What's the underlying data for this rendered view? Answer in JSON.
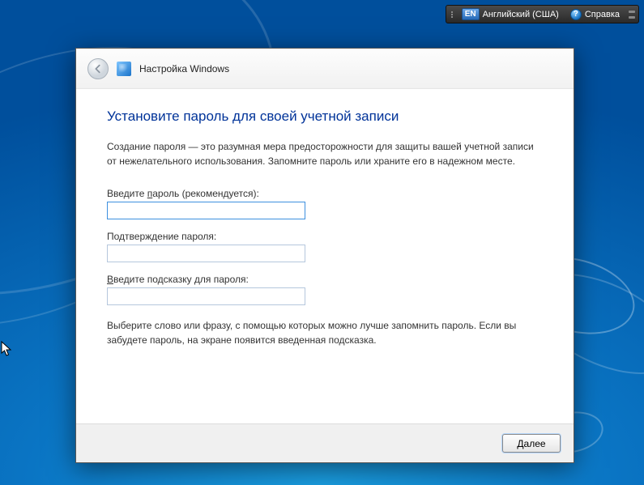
{
  "langbar": {
    "lang_code": "EN",
    "lang_label": "Английский (США)",
    "help_label": "Справка"
  },
  "dialog": {
    "window_title": "Настройка Windows",
    "heading": "Установите пароль для своей учетной записи",
    "description": "Создание пароля — это разумная мера предосторожности для защиты вашей учетной записи от нежелательного использования. Запомните пароль или храните его в надежном месте.",
    "password_label_pre": "Введите ",
    "password_label_ul": "п",
    "password_label_post": "ароль (рекомендуется):",
    "password_value": "",
    "confirm_label": "Подтверждение пароля:",
    "confirm_value": "",
    "hint_label_pre": "",
    "hint_label_ul": "В",
    "hint_label_post": "ведите подсказку для пароля:",
    "hint_value": "",
    "hint_help": "Выберите слово или фразу, с помощью которых можно лучше запомнить пароль. Если вы забудете пароль, на экране появится введенная подсказка.",
    "next_pre": "",
    "next_ul": "Д",
    "next_post": "алее"
  }
}
